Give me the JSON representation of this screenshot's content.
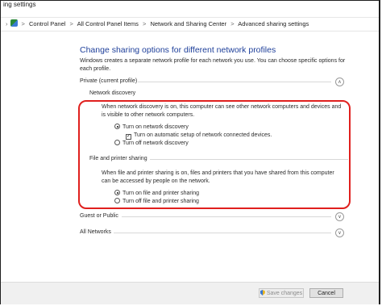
{
  "window": {
    "title": "ing settings"
  },
  "breadcrumb": {
    "items": [
      "Control Panel",
      "All Control Panel Items",
      "Network and Sharing Center",
      "Advanced sharing settings"
    ],
    "separator": ">"
  },
  "page": {
    "heading": "Change sharing options for different network profiles",
    "intro": "Windows creates a separate network profile for each network you use. You can choose specific options for each profile."
  },
  "profiles": {
    "private": {
      "label": "Private (current profile)"
    },
    "guest": {
      "label": "Guest or Public"
    },
    "all": {
      "label": "All Networks"
    }
  },
  "network_discovery": {
    "title": "Network discovery",
    "description": "When network discovery is on, this computer can see other network computers and devices and is visible to other network computers.",
    "option_on": "Turn on network discovery",
    "option_auto": "Turn on automatic setup of network connected devices.",
    "option_off": "Turn off network discovery",
    "selected": "on",
    "auto_checked": true
  },
  "file_printer": {
    "title": "File and printer sharing",
    "description": "When file and printer sharing is on, files and printers that you have shared from this computer can be accessed by people on the network.",
    "option_on": "Turn on file and printer sharing",
    "option_off": "Turn off file and printer sharing",
    "selected": "on"
  },
  "footer": {
    "save_label": "Save changes",
    "cancel_label": "Cancel"
  },
  "colors": {
    "heading": "#1e3f9a",
    "highlight": "#e0201e"
  },
  "icons": {
    "profile_toggle": "chevron-icon",
    "save": "uac-shield-icon"
  }
}
